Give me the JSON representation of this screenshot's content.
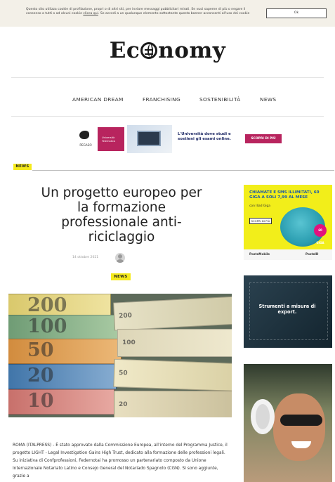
{
  "cookie": {
    "text": "Questo sito utilizza cookie di profilazione, propri o di altri siti, per inviare messaggi pubblicitari mirati. Se vuoi saperne di più o negare il consenso a tutti o ad alcuni cookie ",
    "link": "clicca qui",
    "text_after": ". Se accedi a un qualunque elemento sottostante questo banner acconsenti all'uso dei cookie",
    "ok_label": "Ok"
  },
  "logo": {
    "left": "Ec",
    "right": "nomy"
  },
  "nav": {
    "items": [
      "AMERICAN DREAM",
      "FRANCHISING",
      "SOSTENIBILITÀ",
      "NEWS"
    ]
  },
  "banner": {
    "brand": "PEGASO",
    "pink_label": "Università Telematica",
    "headline": "L'Università dove studi e sostieni gli esami online.",
    "cta": "SCOPRI DI PIÙ"
  },
  "section_label": "NEWS",
  "article": {
    "title": "Un progetto europeo per la formazione professionale anti-riciclaggio",
    "date": "14 ottobre 2021",
    "category": "NEWS",
    "body": "ROMA (ITALPRESS) - È stato approvato dalla Commissione Europea, all'interno del Programma Justice, il progetto LIGHT - Legal Investigation Gains High Trust, dedicato alla formazione delle professioni legali. Su iniziativa di Confprofessioni, Federnotai ha promosso un partenariato composto da Unione Internazionale Notariato Latino e Consejo General del Notariado Spagnolo (CGN). Si sono aggiunte, grazie a"
  },
  "hero_notes": [
    "200",
    "100",
    "50",
    "20",
    "10"
  ],
  "hero_notes_right": [
    "200",
    "100",
    "50",
    "20"
  ],
  "ads": {
    "ad1": {
      "headline": "CHIAMATE E SMS ILLIMITATI, 60 GIGA A SOLI 7,99 AL MESE",
      "subline": "con Iliad Giga",
      "button": "SCOPRI DI PIÙ",
      "badge": "60 GIGA",
      "brand_left": "PosteMobile",
      "brand_right": "PosteID"
    },
    "ad2": {
      "text": "Strumenti a misura di export."
    }
  }
}
